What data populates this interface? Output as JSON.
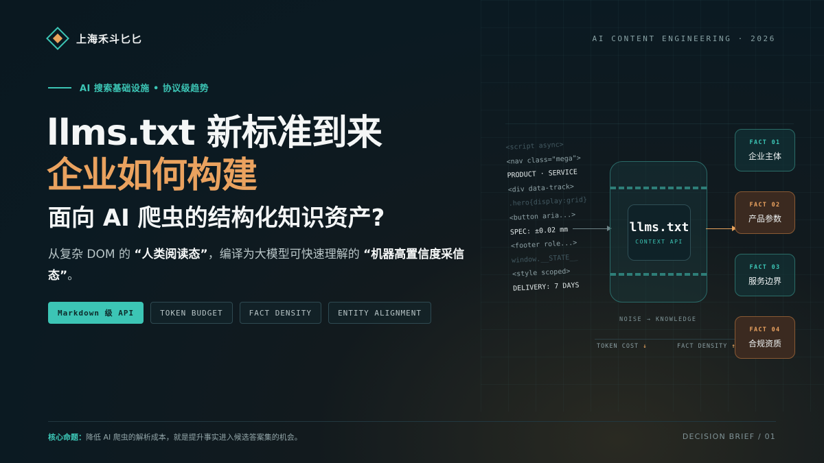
{
  "brand": {
    "name": "上海禾斗匕匕"
  },
  "header": {
    "tagline": "AI CONTENT ENGINEERING · 2026"
  },
  "kicker": "AI 搜索基础设施 • 协议级趋势",
  "headline": {
    "line1": "llms.txt 新标准到来",
    "line2": "企业如何构建",
    "line3": "面向 AI 爬虫的结构化知识资产?"
  },
  "description": {
    "part1": "从复杂 DOM 的 ",
    "bold1": "“人类阅读态”",
    "part2": "，编译为大模型可快速理解的 ",
    "bold2": "“机器高置信度采信态”",
    "part3": "。"
  },
  "tags": [
    {
      "label": "Markdown 级 API",
      "primary": true
    },
    {
      "label": "TOKEN BUDGET"
    },
    {
      "label": "FACT DENSITY"
    },
    {
      "label": "ENTITY ALIGNMENT"
    }
  ],
  "diagram": {
    "code_lines": [
      {
        "text": "<script async>",
        "tone": "dim"
      },
      {
        "text": "<nav class=\"mega\">",
        "tone": "mid"
      },
      {
        "text": "PRODUCT · SERVICE",
        "tone": "bright"
      },
      {
        "text": "<div data-track>",
        "tone": "mid"
      },
      {
        "text": ".hero{display:grid}",
        "tone": "dim"
      },
      {
        "text": "<button aria...>",
        "tone": "mid"
      },
      {
        "text": "SPEC: ±0.02 mm",
        "tone": "bright"
      },
      {
        "text": "<footer role...>",
        "tone": "mid"
      },
      {
        "text": "window.__STATE__",
        "tone": "dim"
      },
      {
        "text": "<style scoped>",
        "tone": "mid"
      },
      {
        "text": "DELIVERY: 7 DAYS",
        "tone": "bright"
      }
    ],
    "core_title": "llms.txt",
    "core_subtitle": "CONTEXT API",
    "noise_label": "NOISE → KNOWLEDGE",
    "metric_token": "TOKEN COST",
    "metric_token_arrow": "↓",
    "metric_fact": "FACT DENSITY",
    "metric_fact_arrow": "↑",
    "facts": [
      {
        "id": "FACT 01",
        "label": "企业主体"
      },
      {
        "id": "FACT 02",
        "label": "产品参数"
      },
      {
        "id": "FACT 03",
        "label": "服务边界"
      },
      {
        "id": "FACT 04",
        "label": "合规资质"
      }
    ]
  },
  "footer": {
    "key_label": "核心命题：",
    "key_text": "降低 AI 爬虫的解析成本，就是提升事实进入候选答案集的机会。",
    "right": "DECISION BRIEF / 01"
  },
  "colors": {
    "accent": "#3cc5b5",
    "highlight": "#eaa25f",
    "background": "#0b1a22"
  }
}
